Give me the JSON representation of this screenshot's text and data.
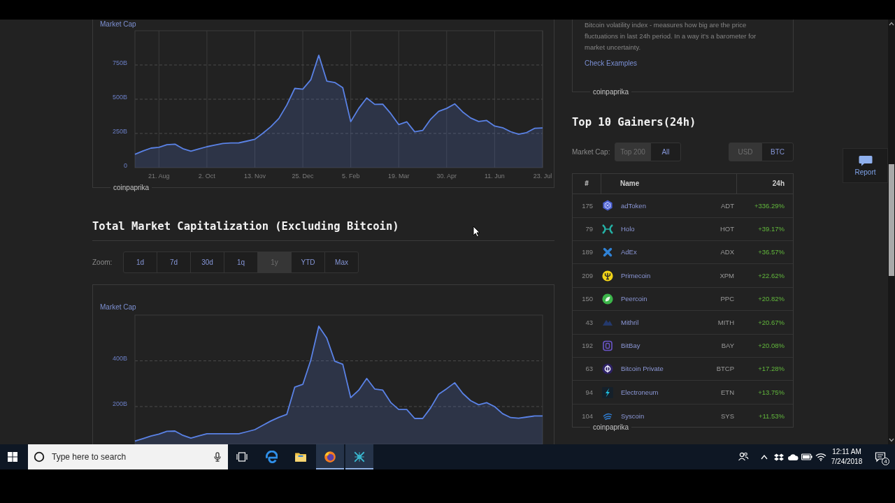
{
  "market_cap_chart": {
    "chart_data": {
      "type": "area",
      "ylabel": "Market Cap",
      "categories": [
        null,
        null,
        null,
        "21. Aug",
        null,
        null,
        null,
        null,
        null,
        "2. Oct",
        null,
        null,
        null,
        null,
        null,
        "13. Nov",
        null,
        null,
        null,
        null,
        null,
        "25. Dec",
        null,
        null,
        null,
        null,
        null,
        "5. Feb",
        null,
        null,
        null,
        null,
        null,
        "19. Mar",
        null,
        null,
        null,
        null,
        null,
        "30. Apr",
        null,
        null,
        null,
        null,
        null,
        "11. Jun",
        null,
        null,
        null,
        null,
        null,
        "23. Jul"
      ],
      "values": [
        98,
        122,
        143,
        149,
        168,
        172,
        139,
        121,
        137,
        153,
        165,
        177,
        180,
        181,
        194,
        207,
        251,
        299,
        359,
        457,
        579,
        573,
        642,
        821,
        632,
        622,
        584,
        336,
        433,
        509,
        462,
        464,
        396,
        315,
        335,
        262,
        272,
        354,
        411,
        433,
        466,
        407,
        363,
        338,
        345,
        304,
        292,
        263,
        244,
        256,
        287,
        290
      ],
      "ylim": [
        0,
        1000
      ],
      "yticks": [
        0,
        {
          "value": 250,
          "label": "250B"
        },
        {
          "value": 500,
          "label": "500B"
        },
        {
          "value": 750,
          "label": "750B"
        }
      ],
      "grid": true
    },
    "source": "coinpaprika"
  },
  "altcoin_market_cap": {
    "title": "Total Market Capitalization (Excluding Bitcoin)",
    "zoom_label": "Zoom:",
    "zoom_options": [
      {
        "label": "1d",
        "selected": false
      },
      {
        "label": "7d",
        "selected": false
      },
      {
        "label": "30d",
        "selected": false
      },
      {
        "label": "1q",
        "selected": false
      },
      {
        "label": "1y",
        "selected": true
      },
      {
        "label": "YTD",
        "selected": false
      },
      {
        "label": "Max",
        "selected": false
      }
    ],
    "chart_data": {
      "type": "area",
      "ylabel": "Market Cap",
      "categories": [
        null,
        null,
        null,
        null,
        null,
        null,
        null,
        null,
        null,
        null,
        null,
        null,
        null,
        null,
        null,
        null,
        null,
        null,
        null,
        null,
        null,
        null,
        null,
        null,
        null,
        null,
        null,
        null,
        null,
        null,
        null,
        null,
        null,
        null,
        null,
        null,
        null,
        null,
        null,
        null,
        null,
        null,
        null,
        null,
        null,
        null,
        null,
        null,
        null,
        null,
        null,
        null
      ],
      "values": [
        49,
        60,
        71,
        80,
        92,
        93,
        74,
        62,
        72,
        81,
        81,
        81,
        81,
        81,
        90,
        99,
        118,
        137,
        153,
        166,
        285,
        297,
        403,
        551,
        499,
        398,
        385,
        239,
        272,
        323,
        277,
        272,
        218,
        187,
        187,
        148,
        148,
        195,
        254,
        278,
        304,
        258,
        226,
        208,
        217,
        200,
        169,
        152,
        149,
        154,
        159,
        159
      ],
      "ylim": [
        35,
        600
      ],
      "yticks": [
        {
          "value": 200,
          "label": "200B"
        },
        {
          "value": 400,
          "label": "400B"
        }
      ],
      "grid": true
    }
  },
  "volatility_info": {
    "description": "Bitcoin volatility index - measures how big are the price fluctuations in last 24h period. In a way it's a barometer for market uncertainty.",
    "link": "Check Examples",
    "source": "coinpaprika"
  },
  "top_gainers": {
    "title": "Top 10 Gainers(24h)",
    "filter_label": "Market Cap:",
    "cap_options": [
      {
        "label": "Top 200",
        "selected": true
      },
      {
        "label": "All",
        "selected": false
      }
    ],
    "currency_options": [
      {
        "label": "USD",
        "selected": true
      },
      {
        "label": "BTC",
        "selected": false
      }
    ],
    "columns": [
      "#",
      "Name",
      "24h"
    ],
    "rows": [
      {
        "rank": "175",
        "name": "adToken",
        "symbol": "ADT",
        "change": "+336.29%"
      },
      {
        "rank": "79",
        "name": "Holo",
        "symbol": "HOT",
        "change": "+39.17%"
      },
      {
        "rank": "189",
        "name": "AdEx",
        "symbol": "ADX",
        "change": "+36.57%"
      },
      {
        "rank": "209",
        "name": "Primecoin",
        "symbol": "XPM",
        "change": "+22.62%"
      },
      {
        "rank": "150",
        "name": "Peercoin",
        "symbol": "PPC",
        "change": "+20.82%"
      },
      {
        "rank": "43",
        "name": "Mithril",
        "symbol": "MITH",
        "change": "+20.67%"
      },
      {
        "rank": "192",
        "name": "BitBay",
        "symbol": "BAY",
        "change": "+20.08%"
      },
      {
        "rank": "63",
        "name": "Bitcoin Private",
        "symbol": "BTCP",
        "change": "+17.28%"
      },
      {
        "rank": "94",
        "name": "Electroneum",
        "symbol": "ETN",
        "change": "+13.75%"
      },
      {
        "rank": "104",
        "name": "Syscoin",
        "symbol": "SYS",
        "change": "+11.53%"
      }
    ],
    "source": "coinpaprika"
  },
  "report_button": {
    "label": "Report"
  },
  "taskbar": {
    "search": {
      "placeholder": "Type here to search"
    },
    "apps": [
      {
        "running": false
      },
      {
        "running": false
      },
      {
        "running": true
      },
      {
        "running": true
      }
    ],
    "time": "12:11 AM",
    "date": "7/24/2018",
    "notification_count": "4"
  }
}
